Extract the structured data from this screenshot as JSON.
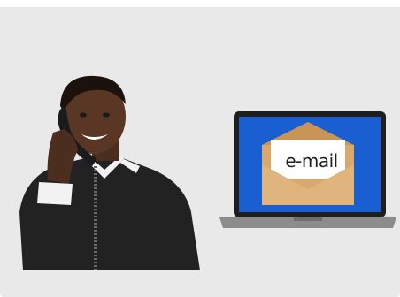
{
  "illustration": {
    "email_text": "e-mail",
    "colors": {
      "background": "#e9e9e9",
      "laptop_screen": "#1a5fd1",
      "envelope": "#d8a86c",
      "sweater": "#222222"
    },
    "icons": [
      "person-on-phone-icon",
      "laptop-icon",
      "envelope-icon"
    ]
  }
}
